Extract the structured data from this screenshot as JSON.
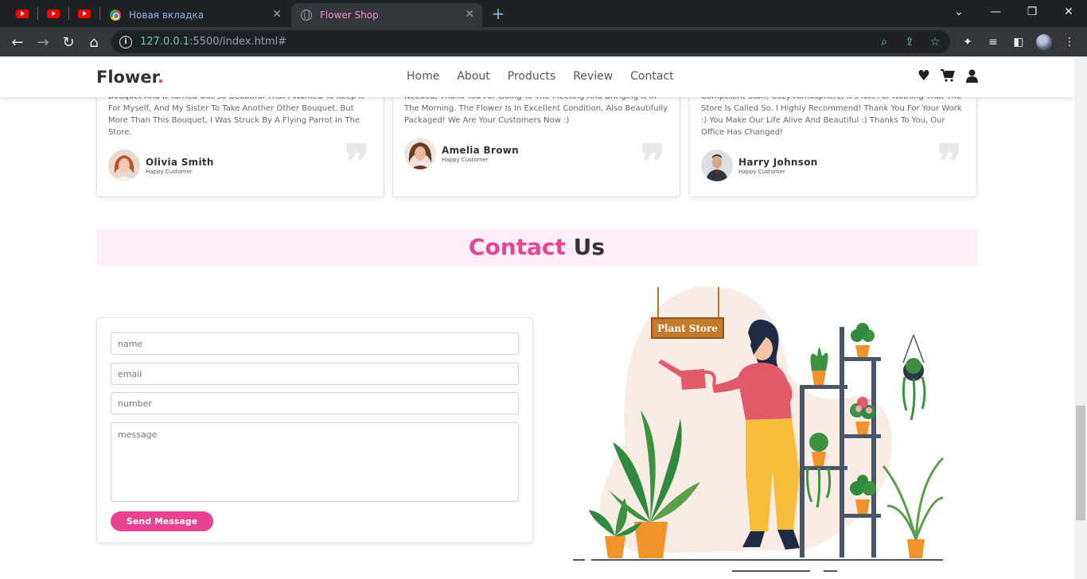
{
  "browser": {
    "tabs": [
      {
        "title": "Новая вкладка",
        "state": "inactive"
      },
      {
        "title": "Flower Shop",
        "state": "active"
      }
    ],
    "url_host": "127.0.0.1",
    "url_rest": ":5500/index.html#"
  },
  "site": {
    "logo": "Flower",
    "logo_dot": ".",
    "nav": [
      "Home",
      "About",
      "Products",
      "Review",
      "Contact"
    ]
  },
  "reviews": [
    {
      "text": "Bouquet And It Turned Out So Beautiful That I Wanted To Keep It For Myself, And My Sister To Take Another Other Bouquet. But More Than This Bouquet, I Was Struck By A Flying Parrot In The Store.",
      "name": "Olivia Smith",
      "role": "Happy Customer"
    },
    {
      "text": "Needed, Thank You For Going To The Meeting And Bringing It In The Morning. The Flower Is In Excellent Condition, Also Beautifully Packaged! We Are Your Customers Now :)",
      "name": "Amelia Brown",
      "role": "Happy Customer"
    },
    {
      "text": "Competent Staff, Cozy Atmosphere, It's Not For Nothing That The Store Is Called So. I Highly Recommend! Thank You For Your Work :) You Make Our Life Alive And Beautiful :) Thanks To You, Our Office Has Changed!",
      "name": "Harry Johnson",
      "role": "Happy Customer"
    }
  ],
  "contact": {
    "heading_accent": "Contact",
    "heading_rest": "Us",
    "fields": {
      "name": "name",
      "email": "email",
      "number": "number",
      "message": "message"
    },
    "button": "Send Message",
    "sign": "Plant Store"
  },
  "colors": {
    "accent": "#e84393",
    "heading_bg": "#ffeef7"
  }
}
